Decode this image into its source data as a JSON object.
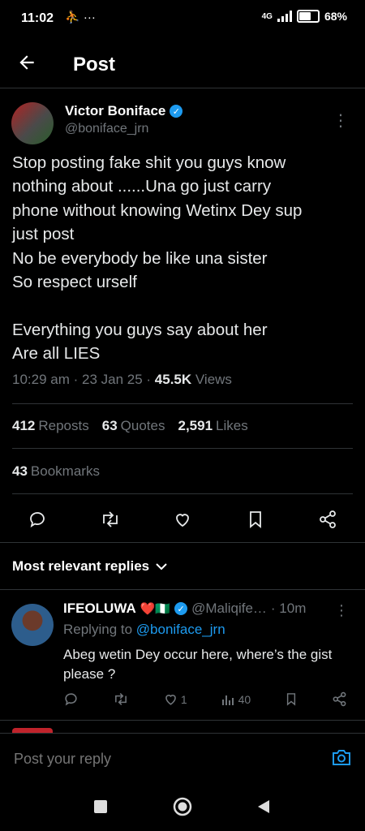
{
  "status_bar": {
    "time": "11:02",
    "icons": "⛹ ···",
    "network": "4G",
    "battery": "68%"
  },
  "header": {
    "title": "Post",
    "back_icon": "arrow-left-icon"
  },
  "tweet": {
    "author_name": "Victor Boniface",
    "author_handle": "@boniface_jrn",
    "lines": [
      "Stop posting fake shit you guys know",
      "nothing about ......Una go just carry",
      "phone without knowing Wetinx Dey sup",
      "just post",
      "No be everybody be like una sister",
      "So respect urself",
      "",
      "Everything you guys say about her",
      "Are all LIES"
    ],
    "time": "10:29 am · 23 Jan 25 · ",
    "views_count": "45.5K",
    "views_label": " Views",
    "reposts_count": "412",
    "reposts_label": "Reposts",
    "quotes_count": "63",
    "quotes_label": "Quotes",
    "likes_count": "2,591",
    "likes_label": "Likes",
    "bookmarks_count": "43",
    "bookmarks_label": "Bookmarks"
  },
  "replies_sort": {
    "label": "Most relevant replies"
  },
  "reply": {
    "name": "IFEOLUWA",
    "emoji": "❤️🇳🇬",
    "handle": "@Maliqife…",
    "age": "· 10m",
    "replying_prefix": "Replying to ",
    "replying_handle": "@boniface_jrn",
    "text": "Abeg wetin Dey occur here, where’s the gist please ?",
    "likes": "1",
    "views": "40"
  },
  "reply_bar": {
    "placeholder": "Post your reply"
  },
  "colors": {
    "accent": "#1d9bf0",
    "muted": "#71767b",
    "background": "#000000",
    "divider": "#2f3336"
  }
}
